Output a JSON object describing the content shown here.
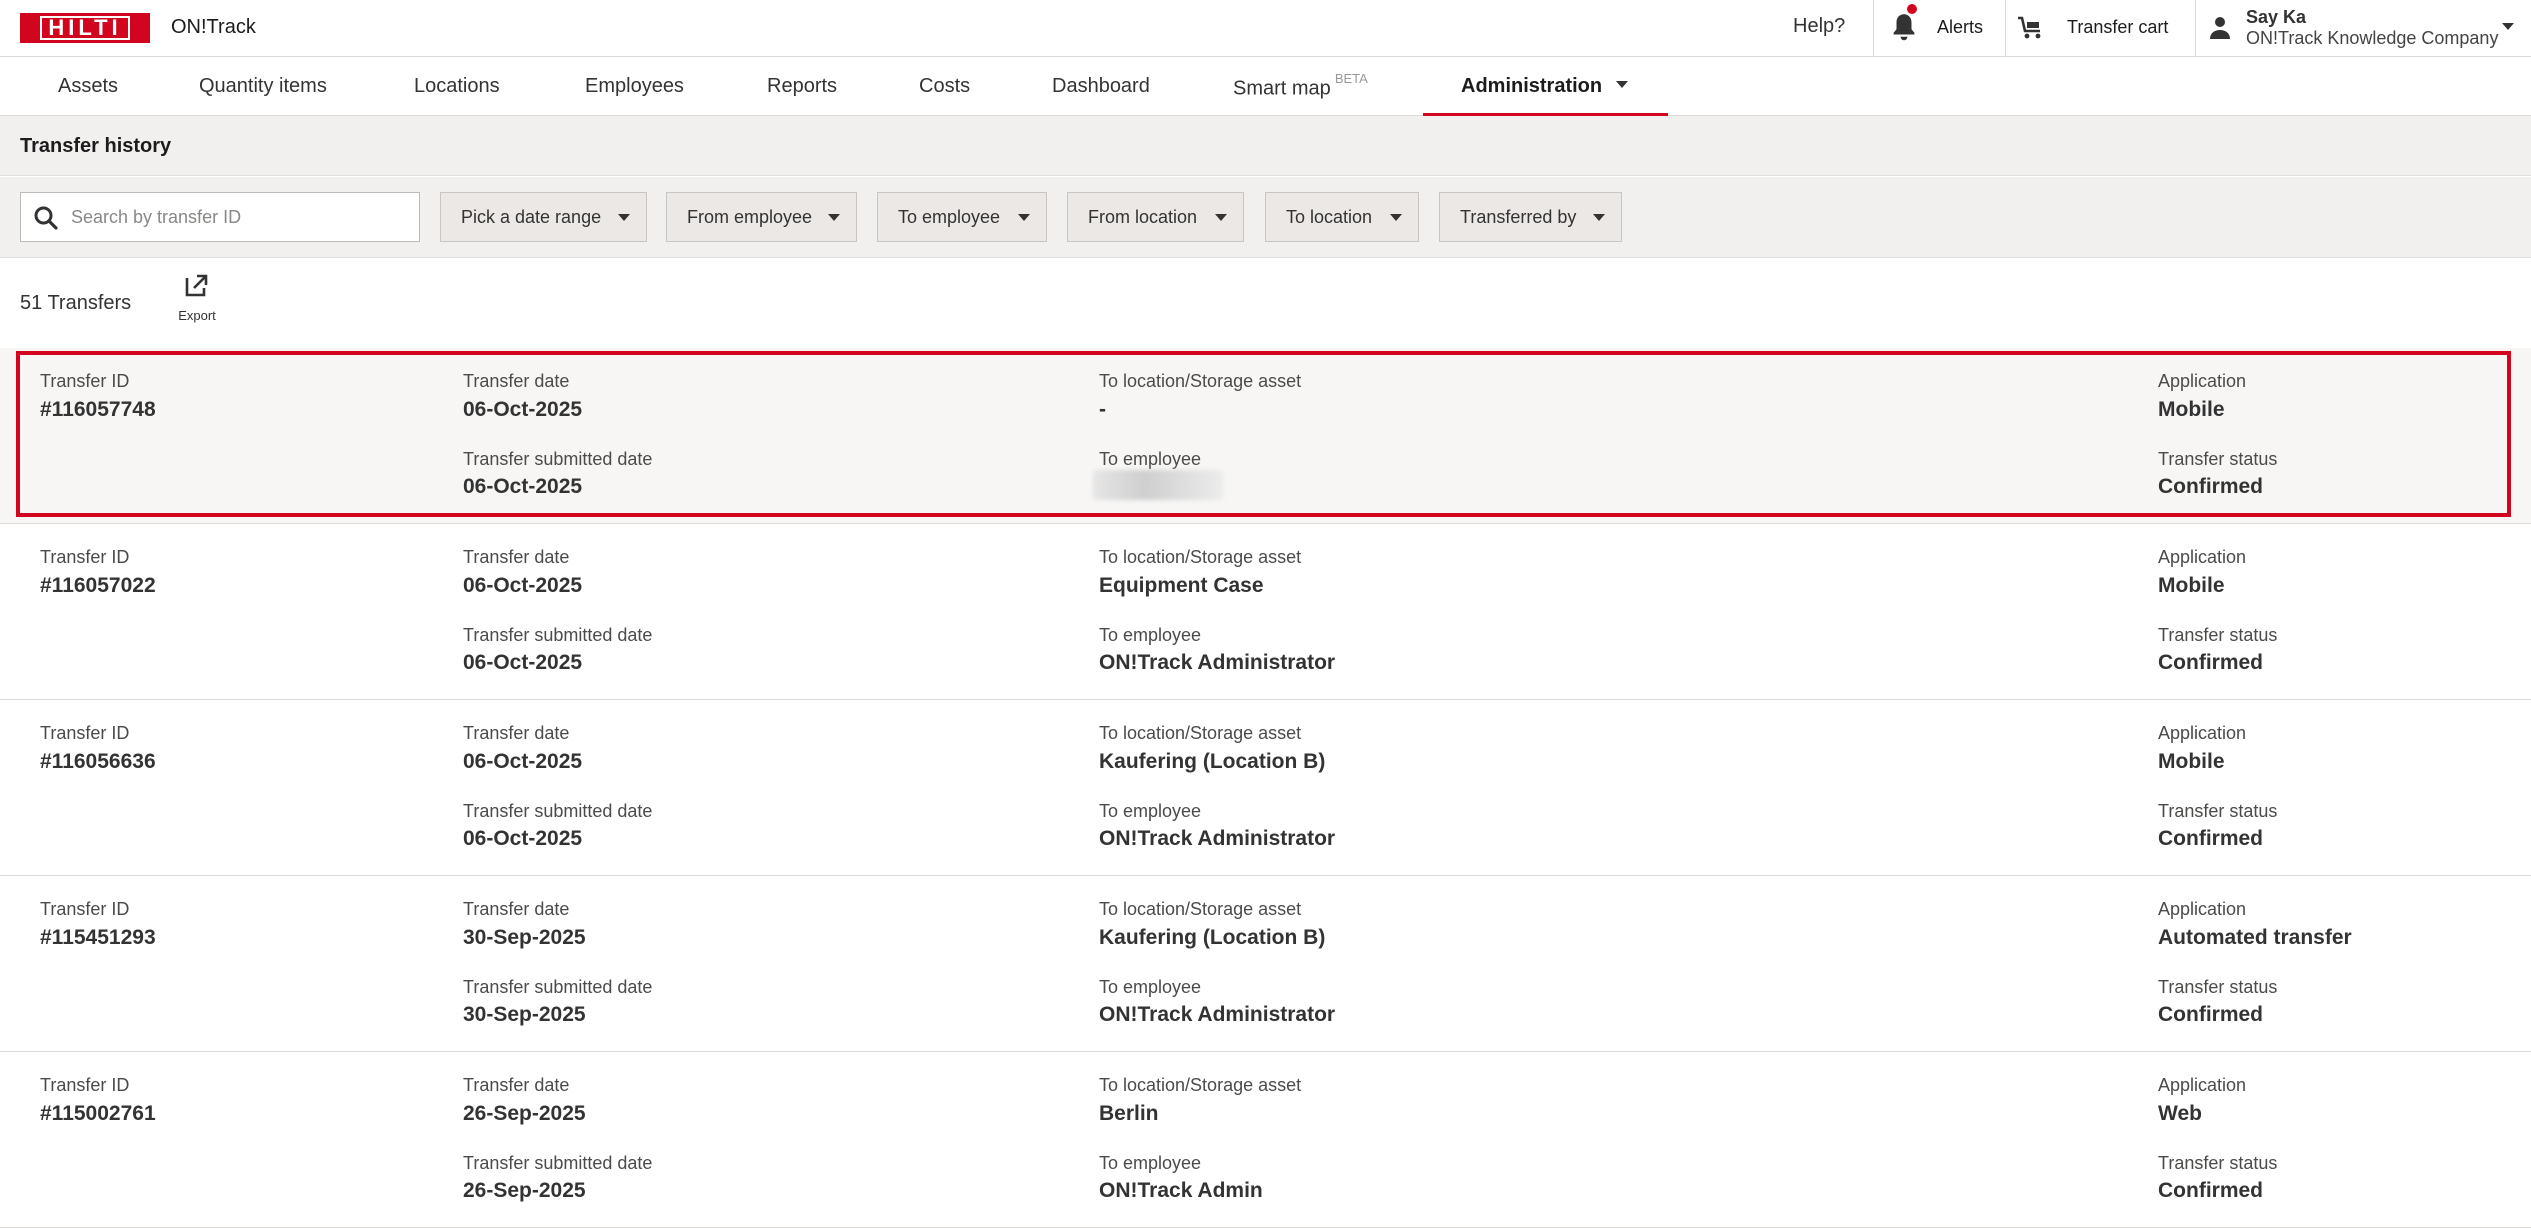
{
  "header": {
    "logo_text": "HILTI",
    "app_name": "ON!Track",
    "help_label": "Help?",
    "alerts_label": "Alerts",
    "transfer_cart_label": "Transfer cart",
    "user_name": "Say Ka",
    "user_company": "ON!Track Knowledge Company",
    "brand_color": "#d2051e"
  },
  "nav": {
    "items": [
      {
        "label": "Assets"
      },
      {
        "label": "Quantity items"
      },
      {
        "label": "Locations"
      },
      {
        "label": "Employees"
      },
      {
        "label": "Reports"
      },
      {
        "label": "Costs"
      },
      {
        "label": "Dashboard"
      },
      {
        "label": "Smart map",
        "badge": "BETA"
      },
      {
        "label": "Administration",
        "active": true
      }
    ]
  },
  "page": {
    "title": "Transfer history"
  },
  "filters": {
    "search_placeholder": "Search by transfer ID",
    "buttons": [
      {
        "label": "Pick a date range"
      },
      {
        "label": "From employee"
      },
      {
        "label": "To employee"
      },
      {
        "label": "From location"
      },
      {
        "label": "To location"
      },
      {
        "label": "Transferred by"
      }
    ]
  },
  "list": {
    "count_label": "51 Transfers",
    "export_label": "Export",
    "labels": {
      "transfer_id": "Transfer ID",
      "transfer_date": "Transfer date",
      "submitted_date": "Transfer submitted date",
      "to_location": "To location/Storage asset",
      "to_employee": "To employee",
      "application": "Application",
      "status": "Transfer status"
    },
    "rows": [
      {
        "id": "#116057748",
        "transfer_date": "06-Oct-2025",
        "submitted_date": "06-Oct-2025",
        "to_location": "-",
        "to_employee": "",
        "to_employee_redacted": true,
        "application": "Mobile",
        "status": "Confirmed",
        "selected": true
      },
      {
        "id": "#116057022",
        "transfer_date": "06-Oct-2025",
        "submitted_date": "06-Oct-2025",
        "to_location": "Equipment Case",
        "to_employee": "ON!Track Administrator",
        "application": "Mobile",
        "status": "Confirmed"
      },
      {
        "id": "#116056636",
        "transfer_date": "06-Oct-2025",
        "submitted_date": "06-Oct-2025",
        "to_location": "Kaufering (Location B)",
        "to_employee": "ON!Track Administrator",
        "application": "Mobile",
        "status": "Confirmed"
      },
      {
        "id": "#115451293",
        "transfer_date": "30-Sep-2025",
        "submitted_date": "30-Sep-2025",
        "to_location": "Kaufering (Location B)",
        "to_employee": "ON!Track Administrator",
        "application": "Automated transfer",
        "status": "Confirmed"
      },
      {
        "id": "#115002761",
        "transfer_date": "26-Sep-2025",
        "submitted_date": "26-Sep-2025",
        "to_location": "Berlin",
        "to_employee": "ON!Track Admin",
        "application": "Web",
        "status": "Confirmed"
      }
    ]
  }
}
